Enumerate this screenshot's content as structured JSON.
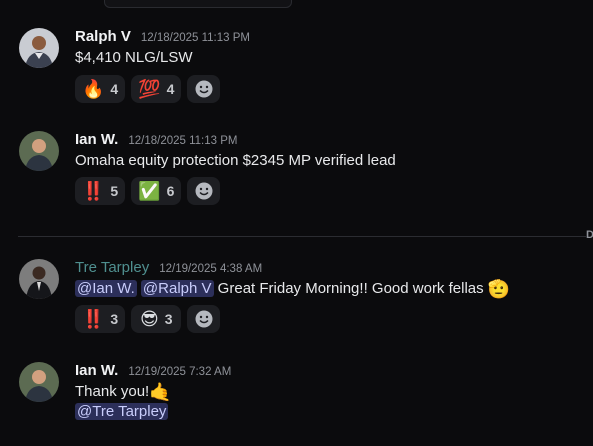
{
  "divider": {
    "label": "D"
  },
  "messages": [
    {
      "username": "Ralph V",
      "timestamp": "12/18/2025 11:13 PM",
      "text": "$4,410 NLG/LSW",
      "reactions": [
        {
          "emoji": "🔥",
          "count": "4"
        },
        {
          "emoji": "💯",
          "count": "4"
        }
      ]
    },
    {
      "username": "Ian W.",
      "timestamp": "12/18/2025 11:13 PM",
      "text": "Omaha equity protection $2345 MP verified lead",
      "reactions": [
        {
          "emoji": "‼️",
          "count": "5"
        },
        {
          "emoji": "✅",
          "count": "6"
        }
      ]
    },
    {
      "username": "Tre Tarpley",
      "timestamp": "12/19/2025 4:38 AM",
      "mention1": "@Ian W.",
      "mention2": "@Ralph V",
      "text": " Great Friday Morning!! Good work fellas ",
      "text_emoji": "🫡",
      "reactions": [
        {
          "emoji": "‼️",
          "count": "3"
        },
        {
          "emoji": "😎",
          "count": "3"
        }
      ]
    },
    {
      "username": "Ian W.",
      "timestamp": "12/19/2025 7:32 AM",
      "text": "Thank you!",
      "text_emoji": "🤙",
      "mention": "@Tre Tarpley"
    }
  ]
}
